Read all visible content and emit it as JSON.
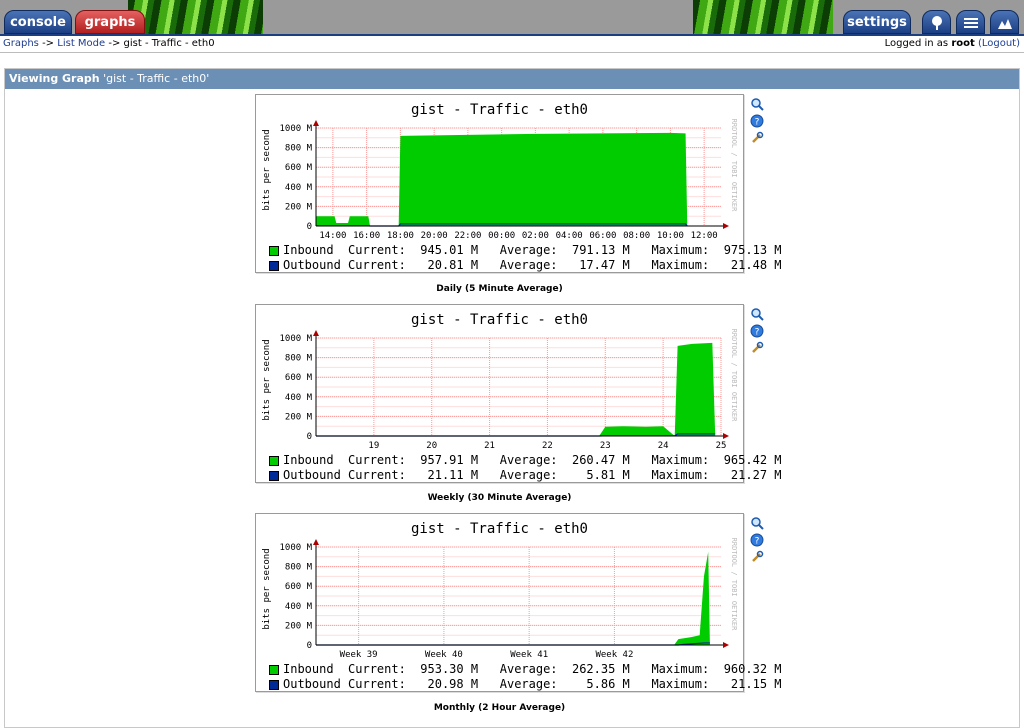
{
  "nav": {
    "tabs": [
      {
        "label": "console"
      },
      {
        "label": "graphs"
      },
      {
        "label": "settings"
      }
    ],
    "icon_buttons": [
      "tree-view-icon",
      "list-view-icon",
      "preview-view-icon"
    ]
  },
  "breadcrumb": {
    "items": [
      "Graphs",
      "List Mode",
      "gist - Traffic - eth0"
    ],
    "separator": "->"
  },
  "login": {
    "prefix": "Logged in as",
    "user": "root",
    "logout": "(Logout)"
  },
  "panel": {
    "heading_bold": "Viewing Graph",
    "heading_rest": "'gist - Traffic - eth0'"
  },
  "colors": {
    "inbound": "#00cc00",
    "outbound": "#002a97",
    "grid_major": "#ff9999",
    "grid_minor": "#ffdddd",
    "head_bar": "#6b8fb5"
  },
  "graphs": [
    {
      "title": "gist - Traffic - eth0",
      "ylabel": "bits per second",
      "watermark": "RRDTOOL / TOBI OETIKER",
      "caption": "Daily (5 Minute Average)",
      "legend": {
        "inbound": {
          "name": "Inbound",
          "current": "945.01 M",
          "average": "791.13 M",
          "maximum": "975.13 M"
        },
        "outbound": {
          "name": "Outbound",
          "current": "20.81 M",
          "average": "17.47 M",
          "maximum": "21.48 M"
        }
      }
    },
    {
      "title": "gist - Traffic - eth0",
      "ylabel": "bits per second",
      "watermark": "RRDTOOL / TOBI OETIKER",
      "caption": "Weekly (30 Minute Average)",
      "legend": {
        "inbound": {
          "name": "Inbound",
          "current": "957.91 M",
          "average": "260.47 M",
          "maximum": "965.42 M"
        },
        "outbound": {
          "name": "Outbound",
          "current": "21.11 M",
          "average": "5.81 M",
          "maximum": "21.27 M"
        }
      }
    },
    {
      "title": "gist - Traffic - eth0",
      "ylabel": "bits per second",
      "watermark": "RRDTOOL / TOBI OETIKER",
      "caption": "Monthly (2 Hour Average)",
      "legend": {
        "inbound": {
          "name": "Inbound",
          "current": "953.30 M",
          "average": "262.35 M",
          "maximum": "960.32 M"
        },
        "outbound": {
          "name": "Outbound",
          "current": "20.98 M",
          "average": "5.86 M",
          "maximum": "21.15 M"
        }
      }
    }
  ],
  "legend_labels": {
    "current": "Current:",
    "average": "Average:",
    "maximum": "Maximum:"
  },
  "chart_data": [
    {
      "type": "area",
      "title": "gist - Traffic - eth0",
      "ylabel": "bits per second",
      "yticks": [
        "0",
        "200 M",
        "400 M",
        "600 M",
        "800 M",
        "1000 M"
      ],
      "ylim": [
        0,
        1000
      ],
      "xticks": [
        "14:00",
        "16:00",
        "18:00",
        "20:00",
        "22:00",
        "00:00",
        "02:00",
        "04:00",
        "06:00",
        "08:00",
        "10:00",
        "12:00"
      ],
      "xlim": [
        13,
        37
      ],
      "grid": true,
      "series": [
        {
          "name": "Inbound",
          "points": [
            [
              13.0,
              100
            ],
            [
              14.1,
              100
            ],
            [
              14.2,
              30
            ],
            [
              14.9,
              30
            ],
            [
              15.0,
              100
            ],
            [
              16.1,
              100
            ],
            [
              16.2,
              0
            ],
            [
              17.9,
              0
            ],
            [
              18.0,
              920
            ],
            [
              22.0,
              930
            ],
            [
              26.0,
              940
            ],
            [
              30.0,
              945
            ],
            [
              34.0,
              950
            ],
            [
              34.9,
              945
            ],
            [
              35.0,
              0
            ]
          ]
        },
        {
          "name": "Outbound",
          "points": [
            [
              13.0,
              2
            ],
            [
              16.1,
              2
            ],
            [
              16.2,
              0
            ],
            [
              17.9,
              0
            ],
            [
              18.0,
              21
            ],
            [
              34.9,
              21
            ],
            [
              35.0,
              0
            ]
          ]
        }
      ]
    },
    {
      "type": "area",
      "title": "gist - Traffic - eth0",
      "ylabel": "bits per second",
      "yticks": [
        "0",
        "200 M",
        "400 M",
        "600 M",
        "800 M",
        "1000 M"
      ],
      "ylim": [
        0,
        1000
      ],
      "xticks": [
        "19",
        "20",
        "21",
        "22",
        "23",
        "24",
        "25"
      ],
      "xlim": [
        18,
        25
      ],
      "grid": true,
      "series": [
        {
          "name": "Inbound",
          "points": [
            [
              18.0,
              0
            ],
            [
              22.0,
              0
            ],
            [
              22.5,
              5
            ],
            [
              22.9,
              5
            ],
            [
              23.0,
              95
            ],
            [
              23.3,
              100
            ],
            [
              23.7,
              95
            ],
            [
              24.0,
              100
            ],
            [
              24.2,
              0
            ],
            [
              24.25,
              920
            ],
            [
              24.5,
              940
            ],
            [
              24.85,
              950
            ],
            [
              24.9,
              0
            ]
          ]
        },
        {
          "name": "Outbound",
          "points": [
            [
              18.0,
              0
            ],
            [
              22.9,
              0
            ],
            [
              23.0,
              2
            ],
            [
              24.2,
              2
            ],
            [
              24.25,
              21
            ],
            [
              24.9,
              21
            ]
          ]
        }
      ]
    },
    {
      "type": "area",
      "title": "gist - Traffic - eth0",
      "ylabel": "bits per second",
      "yticks": [
        "0",
        "200 M",
        "400 M",
        "600 M",
        "800 M",
        "1000 M"
      ],
      "ylim": [
        0,
        1000
      ],
      "xticks": [
        "Week 39",
        "Week 40",
        "Week 41",
        "Week 42"
      ],
      "xlim": [
        38.5,
        43.25
      ],
      "grid": true,
      "series": [
        {
          "name": "Inbound",
          "points": [
            [
              38.5,
              0
            ],
            [
              42.7,
              0
            ],
            [
              42.75,
              60
            ],
            [
              42.9,
              80
            ],
            [
              43.0,
              100
            ],
            [
              43.05,
              700
            ],
            [
              43.1,
              950
            ],
            [
              43.12,
              0
            ]
          ]
        },
        {
          "name": "Outbound",
          "points": [
            [
              38.5,
              0
            ],
            [
              42.75,
              0
            ],
            [
              42.8,
              5
            ],
            [
              43.05,
              21
            ],
            [
              43.12,
              21
            ]
          ]
        }
      ]
    }
  ]
}
